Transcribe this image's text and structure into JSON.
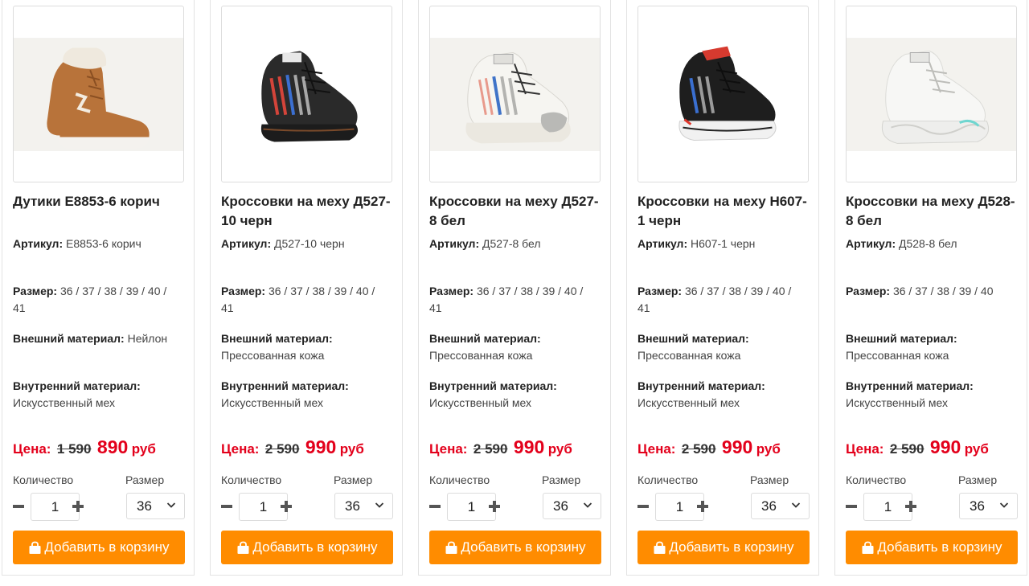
{
  "labels": {
    "article": "Артикул:",
    "size": "Размер:",
    "outer": "Внешний материал:",
    "inner": "Внутренний материал:",
    "price": "Цена:",
    "currency": "руб",
    "quantity": "Количество",
    "size_select": "Размер",
    "add_to_cart": "Добавить в корзину"
  },
  "products": [
    {
      "name": "Дутики Е8853-6 корич",
      "article": "Е8853-6 корич",
      "sizes": "36 / 37 / 38 / 39 / 40 / 41",
      "outer_material": "Нейлон",
      "inner_material": "Искусственный мех",
      "old_price": "1 590",
      "new_price": "890",
      "quantity": "1",
      "selected_size": "36",
      "colors": {
        "body": "#b8733a",
        "accent": "#e8e4dc",
        "sole": "#f2f0ec",
        "bg": "#f3f2ee"
      }
    },
    {
      "name": "Кроссовки на меху Д527-10 черн",
      "article": "Д527-10 черн",
      "sizes": "36 / 37 / 38 / 39 / 40 / 41",
      "outer_material": "Прессованная кожа",
      "inner_material": "Искусственный мех",
      "old_price": "2 590",
      "new_price": "990",
      "quantity": "1",
      "selected_size": "36",
      "colors": {
        "body": "#2a2a2a",
        "accent": "#9a9a9a",
        "sole": "#1f1f1f",
        "bg": "#ffffff"
      }
    },
    {
      "name": "Кроссовки на меху Д527-8 бел",
      "article": "Д527-8 бел",
      "sizes": "36 / 37 / 38 / 39 / 40 / 41",
      "outer_material": "Прессованная кожа",
      "inner_material": "Искусственный мех",
      "old_price": "2 590",
      "new_price": "990",
      "quantity": "1",
      "selected_size": "36",
      "colors": {
        "body": "#f2f1ed",
        "accent": "#b9b9b6",
        "sole": "#e9e6de",
        "bg": "#f3f2ee"
      }
    },
    {
      "name": "Кроссовки на меху Н607-1 черн",
      "article": "Н607-1 черн",
      "sizes": "36 / 37 / 38 / 39 / 40 / 41",
      "outer_material": "Прессованная кожа",
      "inner_material": "Искусственный мех",
      "old_price": "2 590",
      "new_price": "990",
      "quantity": "1",
      "selected_size": "36",
      "colors": {
        "body": "#1e1e1e",
        "accent": "#d63a2f",
        "sole": "#f1f1f1",
        "bg": "#ffffff"
      }
    },
    {
      "name": "Кроссовки на меху Д528-8 бел",
      "article": "Д528-8 бел",
      "sizes": "36 / 37 / 38 / 39 / 40",
      "outer_material": "Прессованная кожа",
      "inner_material": "Искусственный мех",
      "old_price": "2 590",
      "new_price": "990",
      "quantity": "1",
      "selected_size": "36",
      "colors": {
        "body": "#f4f4f2",
        "accent": "#d9d9d6",
        "sole": "#ececea",
        "bg": "#f3f2ee"
      }
    }
  ]
}
